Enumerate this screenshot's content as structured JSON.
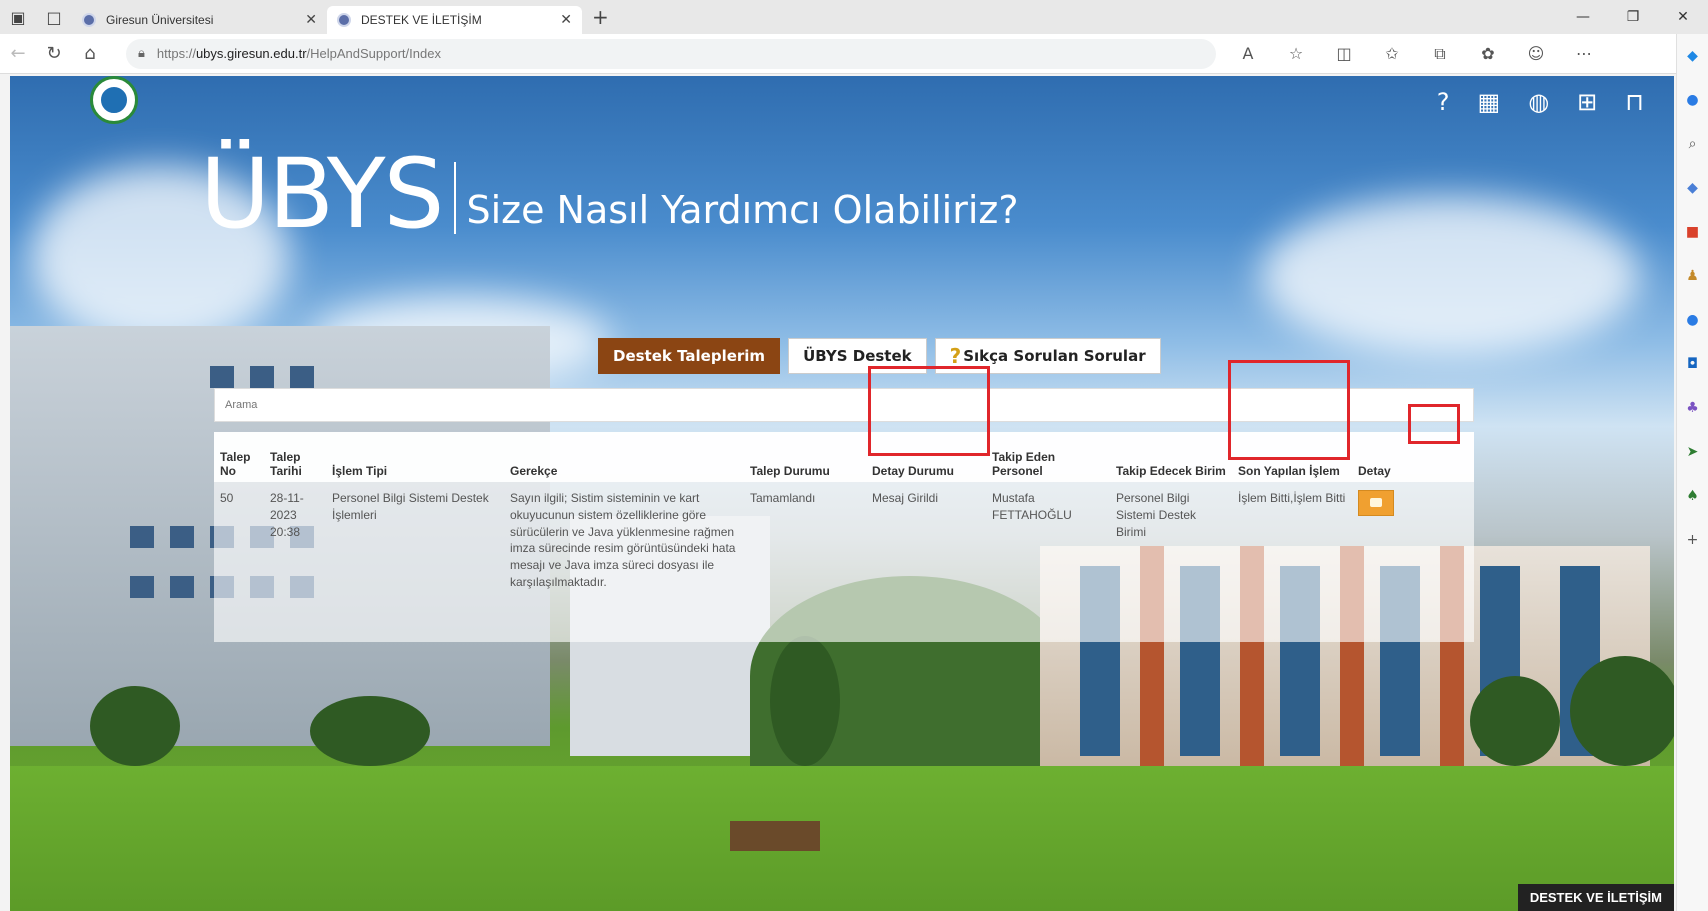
{
  "browser": {
    "tabs": [
      {
        "label": "Giresun Üniversitesi",
        "active": false
      },
      {
        "label": "DESTEK VE İLETİŞİM",
        "active": true
      }
    ],
    "url_prefix": "https://",
    "url_host": "ubys.giresun.edu.tr",
    "url_path": "/HelpAndSupport/Index"
  },
  "header": {
    "brand": "ÜBYS",
    "subtitle": "Size Nasıl Yardımcı Olabiliriz?"
  },
  "nav_buttons": {
    "support_requests": "Destek Taleplerim",
    "ubys_support": "ÜBYS Destek",
    "faq": "Sıkça Sorulan Sorular"
  },
  "search": {
    "placeholder": "Arama"
  },
  "table": {
    "headers": {
      "talep_no": "Talep No",
      "talep_tarihi": "Talep Tarihi",
      "islem_tipi": "İşlem Tipi",
      "gerekce": "Gerekçe",
      "talep_durumu": "Talep Durumu",
      "detay_durumu": "Detay Durumu",
      "takip_eden": "Takip Eden Personel",
      "takip_edecek": "Takip Edecek Birim",
      "son_islem": "Son Yapılan İşlem",
      "detay": "Detay"
    },
    "row": {
      "talep_no": "50",
      "talep_tarihi": "28-11-2023 20:38",
      "islem_tipi": "Personel Bilgi Sistemi Destek İşlemleri",
      "gerekce": "Sayın ilgili; Sistim sisteminin ve kart okuyucunun sistem özelliklerine göre sürücülerin ve Java yüklenmesine rağmen imza sürecinde resim görüntüsündeki hata mesajı ve Java imza süreci dosyası ile karşılaşılmaktadır.",
      "talep_durumu": "Tamamlandı",
      "detay_durumu": "Mesaj Girildi",
      "takip_eden": "Mustafa FETTAHOĞLU",
      "takip_edecek": "Personel Bilgi Sistemi Destek Birimi",
      "son_islem": "İşlem Bitti,İşlem Bitti"
    }
  },
  "footer": {
    "badge": "DESTEK VE İLETİŞİM"
  },
  "colors": {
    "primary_button": "#8b4513",
    "highlight": "#e0262b",
    "detail_button": "#f0a030"
  }
}
